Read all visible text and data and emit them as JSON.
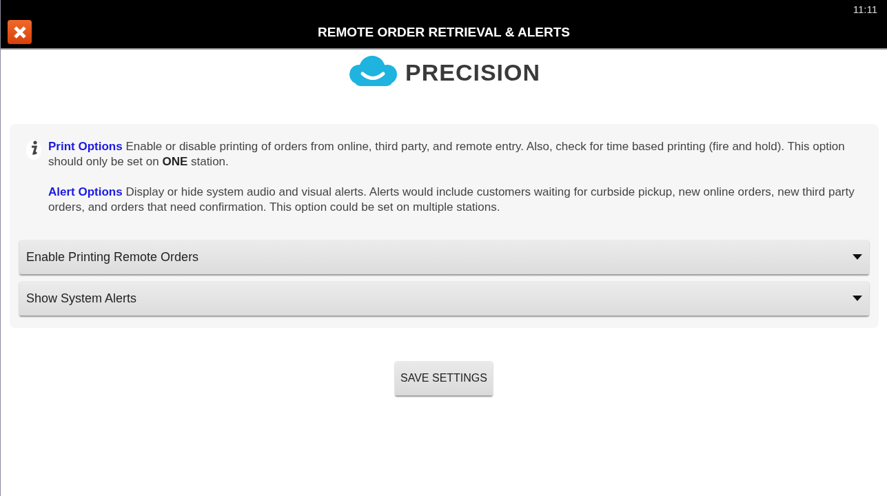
{
  "status_bar": {
    "time": "11:11"
  },
  "title_bar": {
    "title": "REMOTE ORDER RETRIEVAL & ALERTS"
  },
  "logo": {
    "text": "PRECISION"
  },
  "info": [
    {
      "heading": "Print Options",
      "text": "Enable or disable printing of orders from online, third party, and remote entry. Also, check for time based printing (fire and hold). This option should only be set on **ONE** station."
    },
    {
      "heading": "Alert Options",
      "text": "Display or hide system audio and visual alerts. Alerts would include customers waiting for curbside pickup, new online orders, new third party orders, and orders that need confirmation. This option could be set on multiple stations."
    }
  ],
  "dropdowns": [
    {
      "label": "Enable Printing Remote Orders",
      "expanded": false
    },
    {
      "label": "Show System Alerts",
      "expanded": false
    }
  ],
  "save_button": {
    "label": "SAVE SETTINGS"
  }
}
